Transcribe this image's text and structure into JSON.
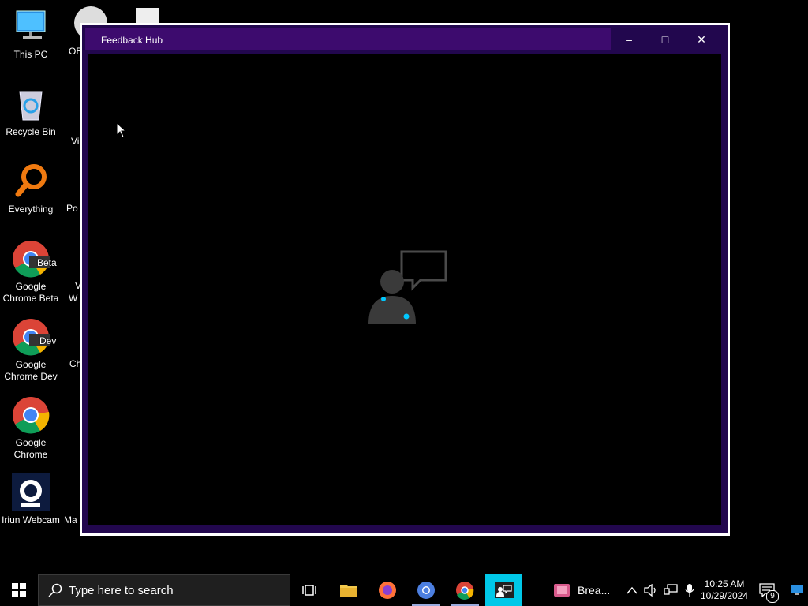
{
  "desktop": {
    "icons": [
      {
        "label_line1": "This PC",
        "label_line2": ""
      },
      {
        "label_line1": "Recycle Bin",
        "label_line2": ""
      },
      {
        "label_line1": "Everything",
        "label_line2": ""
      },
      {
        "label_line1": "Google",
        "label_line2": "Chrome Beta",
        "badge": "Beta"
      },
      {
        "label_line1": "Google",
        "label_line2": "Chrome Dev",
        "badge": "Dev"
      },
      {
        "label_line1": "Google",
        "label_line2": "Chrome"
      },
      {
        "label_line1": "Iriun Webcam",
        "label_line2": ""
      }
    ],
    "partial_labels": [
      "OB",
      "Vi",
      "Po",
      "V",
      "W",
      "Ch",
      "Ma"
    ]
  },
  "window": {
    "title": "Feedback Hub",
    "minimize_glyph": "–",
    "maximize_glyph": "□",
    "close_glyph": "✕"
  },
  "taskbar": {
    "search_placeholder": "Type here to search",
    "app_label": "Brea...",
    "time": "10:25 AM",
    "date": "10/29/2024",
    "notification_count": "9"
  },
  "colors": {
    "titlebar": "#3d0b6e",
    "window_frame": "#22074e",
    "accent": "#00c8ff"
  }
}
